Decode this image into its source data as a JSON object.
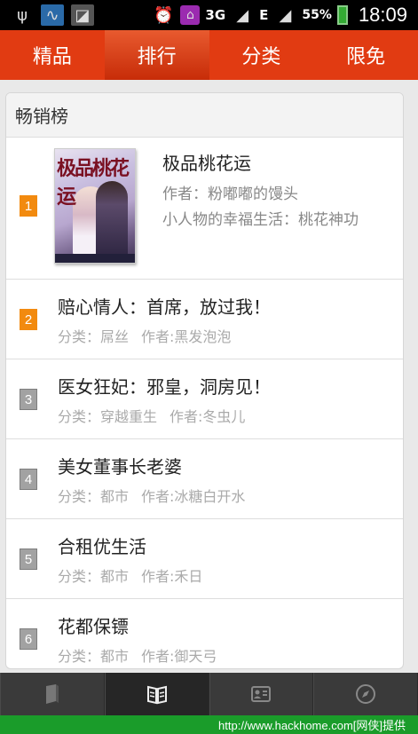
{
  "status_bar": {
    "network": "3G",
    "data_type": "E",
    "battery_percent": "55%",
    "time": "18:09"
  },
  "top_tabs": [
    {
      "label": "精品",
      "active": false
    },
    {
      "label": "排行",
      "active": true
    },
    {
      "label": "分类",
      "active": false
    },
    {
      "label": "限免",
      "active": false
    }
  ],
  "section_title": "畅销榜",
  "featured": {
    "rank": "1",
    "cover_text": "极品桃花运",
    "title": "极品桃花运",
    "author": "作者：粉嘟嘟的馒头",
    "description": "小人物的幸福生活：桃花神功"
  },
  "list": [
    {
      "rank": "2",
      "hot": true,
      "title": "赔心情人：首席，放过我！",
      "category": "分类：屌丝",
      "author": "作者:黑发泡泡"
    },
    {
      "rank": "3",
      "hot": false,
      "title": "医女狂妃：邪皇，洞房见！",
      "category": "分类：穿越重生",
      "author": "作者:冬虫儿"
    },
    {
      "rank": "4",
      "hot": false,
      "title": "美女董事长老婆",
      "category": "分类：都市",
      "author": "作者:冰糖白开水"
    },
    {
      "rank": "5",
      "hot": false,
      "title": "合租优生活",
      "category": "分类：都市",
      "author": "作者:禾日"
    },
    {
      "rank": "6",
      "hot": false,
      "title": "花都保镖",
      "category": "分类：都市",
      "author": "作者:御天弓"
    }
  ],
  "bottom_nav": [
    {
      "icon": "book-icon",
      "active": false
    },
    {
      "icon": "open-book-icon",
      "active": true
    },
    {
      "icon": "id-card-icon",
      "active": false
    },
    {
      "icon": "compass-icon",
      "active": false
    }
  ],
  "footer": "http://www.hackhome.com[网侠]提供"
}
